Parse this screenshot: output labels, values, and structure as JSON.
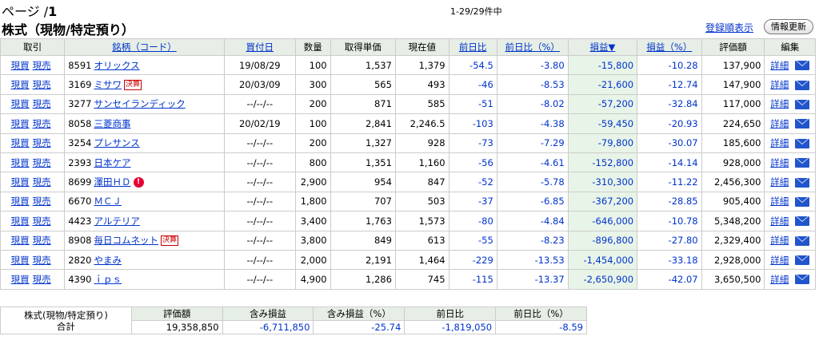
{
  "header": {
    "page_prefix": "ページ /",
    "page_number": "1",
    "count": "1-29/29件中",
    "title": "株式（現物/特定預り）",
    "sort_link": "登録順表示",
    "refresh_button": "情報更新"
  },
  "columns": [
    "取引",
    "銘柄（コード）",
    "買付日",
    "数量",
    "取得単価",
    "現在値",
    "前日比",
    "前日比（%）",
    "損益▼",
    "損益（%）",
    "評価額",
    "編集"
  ],
  "actions": {
    "buy": "現買",
    "sell": "現売",
    "detail": "詳細"
  },
  "rows": [
    {
      "code": "8591",
      "name": "オリックス",
      "badge": "",
      "alert": false,
      "date": "19/08/29",
      "qty": "100",
      "cost": "1,537",
      "price": "1,379",
      "chg": "-54.5",
      "chg_pct": "-3.80",
      "pl": "-15,800",
      "pl_pct": "-10.28",
      "value": "137,900"
    },
    {
      "code": "3169",
      "name": "ミサワ",
      "badge": "決算",
      "alert": false,
      "date": "20/03/09",
      "qty": "300",
      "cost": "565",
      "price": "493",
      "chg": "-46",
      "chg_pct": "-8.53",
      "pl": "-21,600",
      "pl_pct": "-12.74",
      "value": "147,900"
    },
    {
      "code": "3277",
      "name": "サンセイランディック",
      "badge": "",
      "alert": false,
      "date": "--/--/--",
      "qty": "200",
      "cost": "871",
      "price": "585",
      "chg": "-51",
      "chg_pct": "-8.02",
      "pl": "-57,200",
      "pl_pct": "-32.84",
      "value": "117,000"
    },
    {
      "code": "8058",
      "name": "三菱商事",
      "badge": "",
      "alert": false,
      "date": "20/02/19",
      "qty": "100",
      "cost": "2,841",
      "price": "2,246.5",
      "chg": "-103",
      "chg_pct": "-4.38",
      "pl": "-59,450",
      "pl_pct": "-20.93",
      "value": "224,650"
    },
    {
      "code": "3254",
      "name": "プレサンス",
      "badge": "",
      "alert": false,
      "date": "--/--/--",
      "qty": "200",
      "cost": "1,327",
      "price": "928",
      "chg": "-73",
      "chg_pct": "-7.29",
      "pl": "-79,800",
      "pl_pct": "-30.07",
      "value": "185,600"
    },
    {
      "code": "2393",
      "name": "日本ケア",
      "badge": "",
      "alert": false,
      "date": "--/--/--",
      "qty": "800",
      "cost": "1,351",
      "price": "1,160",
      "chg": "-56",
      "chg_pct": "-4.61",
      "pl": "-152,800",
      "pl_pct": "-14.14",
      "value": "928,000"
    },
    {
      "code": "8699",
      "name": "澤田ＨＤ",
      "badge": "",
      "alert": true,
      "date": "--/--/--",
      "qty": "2,900",
      "cost": "954",
      "price": "847",
      "chg": "-52",
      "chg_pct": "-5.78",
      "pl": "-310,300",
      "pl_pct": "-11.22",
      "value": "2,456,300"
    },
    {
      "code": "6670",
      "name": "ＭＣＪ",
      "badge": "",
      "alert": false,
      "date": "--/--/--",
      "qty": "1,800",
      "cost": "707",
      "price": "503",
      "chg": "-37",
      "chg_pct": "-6.85",
      "pl": "-367,200",
      "pl_pct": "-28.85",
      "value": "905,400"
    },
    {
      "code": "4423",
      "name": "アルテリア",
      "badge": "",
      "alert": false,
      "date": "--/--/--",
      "qty": "3,400",
      "cost": "1,763",
      "price": "1,573",
      "chg": "-80",
      "chg_pct": "-4.84",
      "pl": "-646,000",
      "pl_pct": "-10.78",
      "value": "5,348,200"
    },
    {
      "code": "8908",
      "name": "毎日コムネット",
      "badge": "決算",
      "alert": false,
      "date": "--/--/--",
      "qty": "3,800",
      "cost": "849",
      "price": "613",
      "chg": "-55",
      "chg_pct": "-8.23",
      "pl": "-896,800",
      "pl_pct": "-27.80",
      "value": "2,329,400"
    },
    {
      "code": "2820",
      "name": "やまみ",
      "badge": "",
      "alert": false,
      "date": "--/--/--",
      "qty": "2,000",
      "cost": "2,191",
      "price": "1,464",
      "chg": "-229",
      "chg_pct": "-13.53",
      "pl": "-1,454,000",
      "pl_pct": "-33.18",
      "value": "2,928,000"
    },
    {
      "code": "4390",
      "name": "ｉｐｓ",
      "badge": "",
      "alert": false,
      "date": "--/--/--",
      "qty": "4,900",
      "cost": "1,286",
      "price": "745",
      "chg": "-115",
      "chg_pct": "-13.37",
      "pl": "-2,650,900",
      "pl_pct": "-42.07",
      "value": "3,650,500"
    }
  ],
  "summary": {
    "label_line1": "株式(現物/特定預り)",
    "label_line2": "合計",
    "headers": [
      "評価額",
      "含み損益",
      "含み損益（%）",
      "前日比",
      "前日比（%）"
    ],
    "values": [
      "19,358,850",
      "-6,711,850",
      "-25.74",
      "-1,819,050",
      "-8.59"
    ]
  },
  "colors": {
    "link": "#0033cc",
    "header_bg": "#e6eee6",
    "highlight_col": "#e8f4e8",
    "badge": "#cc0000"
  }
}
